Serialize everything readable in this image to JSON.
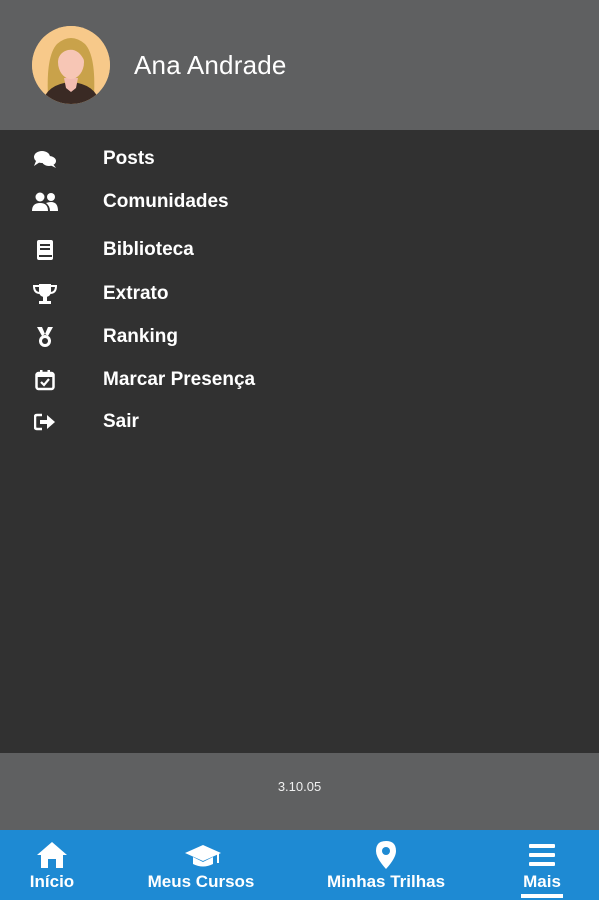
{
  "header": {
    "user_name": "Ana Andrade",
    "avatar_icon": "user-avatar-icon"
  },
  "menu": {
    "items": [
      {
        "label": "Posts",
        "icon": "comments-icon"
      },
      {
        "label": "Comunidades",
        "icon": "users-icon"
      },
      {
        "label": "Biblioteca",
        "icon": "book-icon"
      },
      {
        "label": "Extrato",
        "icon": "trophy-icon"
      },
      {
        "label": "Ranking",
        "icon": "medal-icon"
      },
      {
        "label": "Marcar Presença",
        "icon": "calendar-check-icon"
      },
      {
        "label": "Sair",
        "icon": "sign-out-icon"
      }
    ]
  },
  "footer": {
    "version": "3.10.05"
  },
  "bottom_nav": {
    "items": [
      {
        "label": "Início",
        "icon": "home-icon"
      },
      {
        "label": "Meus Cursos",
        "icon": "graduation-cap-icon"
      },
      {
        "label": "Minhas Trilhas",
        "icon": "map-marker-icon"
      },
      {
        "label": "Mais",
        "icon": "menu-icon",
        "active": true
      }
    ]
  },
  "colors": {
    "header_bg": "#5f6061",
    "menu_bg": "#313131",
    "nav_bg": "#1e8ad3",
    "text": "#ffffff"
  }
}
